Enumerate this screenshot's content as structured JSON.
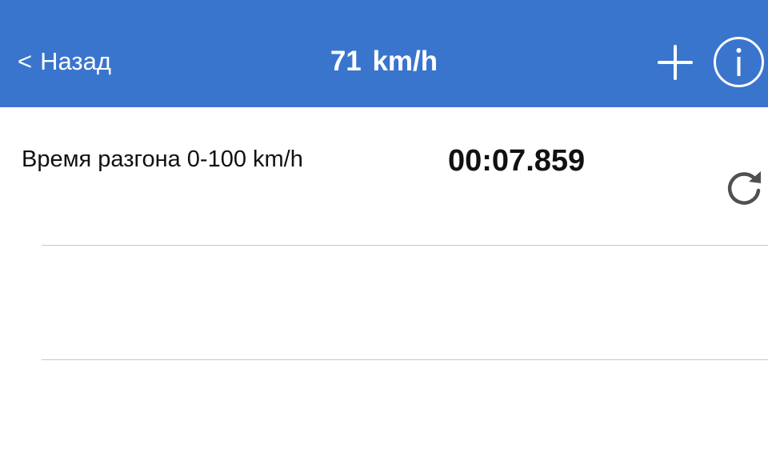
{
  "navbar": {
    "back_label": "Назад",
    "back_chevron": "<",
    "title": "71 km/h",
    "add_icon": "plus-icon",
    "info_icon": "info-icon",
    "background_color": "#3a75cd"
  },
  "result": {
    "label": "Время разгона  0-100 km/h",
    "time": "00:07.859",
    "refresh_icon": "refresh-icon"
  }
}
